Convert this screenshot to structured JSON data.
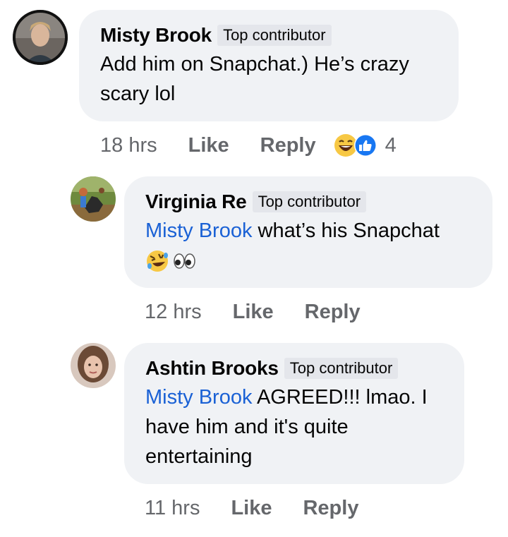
{
  "comments": [
    {
      "author": "Misty Brook",
      "badge": "Top contributor",
      "mention": "",
      "text": "Add him on Snapchat.) He’s crazy scary lol",
      "time": "18 hrs",
      "like_label": "Like",
      "reply_label": "Reply",
      "reaction_icons": [
        "laughing-emoji-icon",
        "like-thumb-icon"
      ],
      "reaction_count": "4"
    },
    {
      "author": "Virginia Re",
      "badge": "Top contributor",
      "mention": "Misty Brook",
      "text": "what’s his Snapchat",
      "emojis": [
        "rolling-laughing-emoji-icon",
        "eyes-emoji-icon"
      ],
      "time": "12 hrs",
      "like_label": "Like",
      "reply_label": "Reply"
    },
    {
      "author": "Ashtin Brooks",
      "badge": "Top contributor",
      "mention": "Misty Brook",
      "text": "AGREED!!! lmao. I have him and it's quite entertaining",
      "time": "11 hrs",
      "like_label": "Like",
      "reply_label": "Reply"
    }
  ],
  "colors": {
    "bubble": "#f0f2f5",
    "mention": "#1a61d5",
    "meta": "#65676b",
    "like_blue": "#1877f2",
    "emoji_yellow": "#f7c844"
  }
}
